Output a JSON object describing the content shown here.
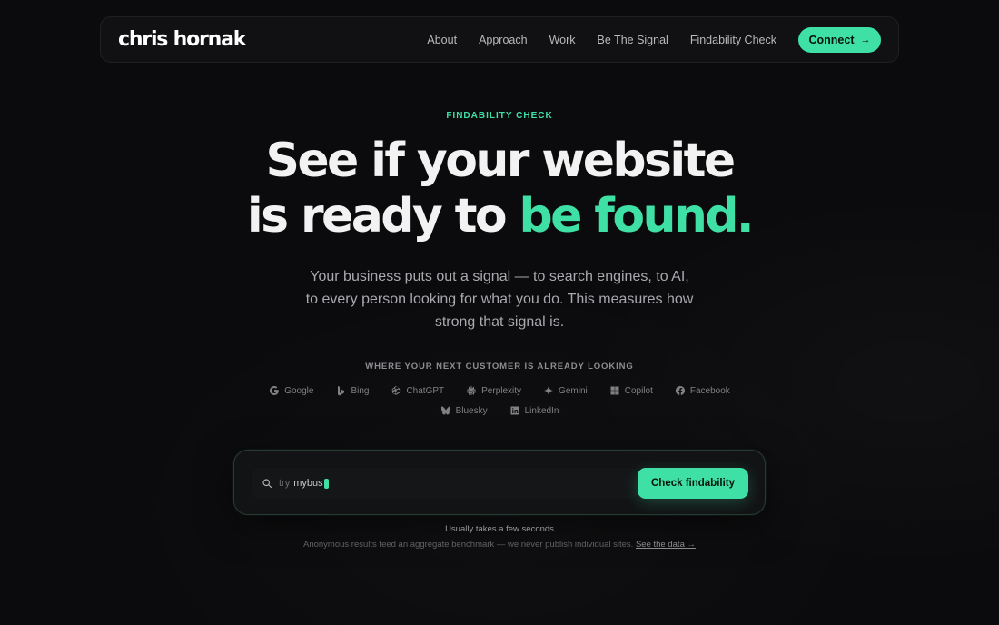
{
  "nav": {
    "logo": "chris hornak",
    "links": [
      "About",
      "Approach",
      "Work",
      "Be The Signal",
      "Findability Check"
    ],
    "connect_label": "Connect",
    "connect_icon": "arrow-right-icon"
  },
  "hero": {
    "eyebrow": "FINDABILITY CHECK",
    "headline_line1": "See if your website",
    "headline_line2_plain": "is ready to ",
    "headline_line2_accent": "be found.",
    "subtext_line1": "Your business puts out a signal — to search engines, to AI,",
    "subtext_line2": "to every person looking for what you do. This measures how",
    "subtext_line3": "strong that signal is."
  },
  "platforms": {
    "heading": "WHERE YOUR NEXT CUSTOMER IS ALREADY LOOKING",
    "items": [
      {
        "label": "Google",
        "icon": "google-icon"
      },
      {
        "label": "Bing",
        "icon": "bing-icon"
      },
      {
        "label": "ChatGPT",
        "icon": "chatgpt-icon"
      },
      {
        "label": "Perplexity",
        "icon": "perplexity-icon"
      },
      {
        "label": "Gemini",
        "icon": "gemini-icon"
      },
      {
        "label": "Copilot",
        "icon": "copilot-icon"
      },
      {
        "label": "Facebook",
        "icon": "facebook-icon"
      },
      {
        "label": "Bluesky",
        "icon": "bluesky-icon"
      },
      {
        "label": "LinkedIn",
        "icon": "linkedin-icon"
      }
    ]
  },
  "search": {
    "prefix": "try",
    "value": "mybus",
    "button_label": "Check findability",
    "accent_color": "#3ee0a6"
  },
  "notes": {
    "line1": "Usually takes a few seconds",
    "line2": "Anonymous results feed an aggregate benchmark — we never publish individual sites.",
    "link": "See the data →"
  }
}
